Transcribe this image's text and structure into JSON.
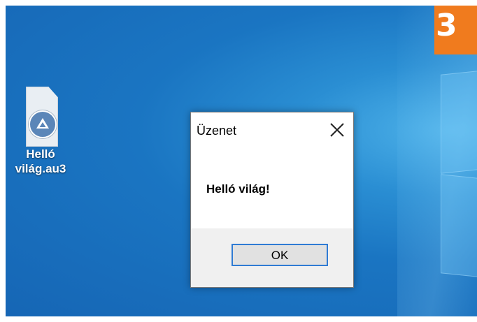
{
  "badge": {
    "text": "3",
    "color": "#f07b1e"
  },
  "desktop": {
    "icon": {
      "name": "autoit-script-icon",
      "label_line1": "Helló",
      "label_line2": "világ.au3"
    },
    "accent": "#1a75c2"
  },
  "dialog": {
    "title": "Üzenet",
    "close_icon": "close-icon",
    "message": "Helló világ!",
    "ok_label": "OK"
  }
}
